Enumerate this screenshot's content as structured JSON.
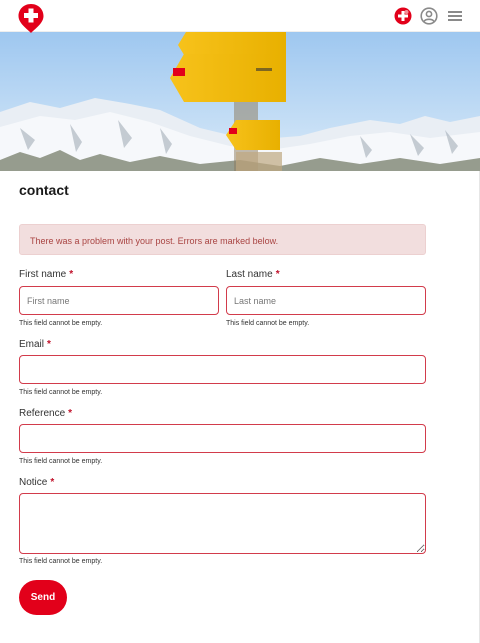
{
  "header": {
    "logo_icon": "swiss-cross-map-pin-icon",
    "icons": [
      "swiss-cross-badge-icon",
      "user-account-icon",
      "menu-icon"
    ],
    "brand_color": "#e2001a"
  },
  "hero": {
    "image": "mountain-signposts-photo"
  },
  "page": {
    "title": "contact"
  },
  "alert": {
    "text": "There was a problem with your post. Errors are marked below."
  },
  "form": {
    "required_mark": "*",
    "first_name": {
      "label": "First name",
      "placeholder": "First name",
      "value": "",
      "error": "This field cannot be empty."
    },
    "last_name": {
      "label": "Last name",
      "placeholder": "Last name",
      "value": "",
      "error": "This field cannot be empty."
    },
    "email": {
      "label": "Email",
      "value": "",
      "error": "This field cannot be empty."
    },
    "reference": {
      "label": "Reference",
      "value": "",
      "error": "This field cannot be empty."
    },
    "notice": {
      "label": "Notice",
      "value": "",
      "error": "This field cannot be empty."
    },
    "submit_label": "Send"
  },
  "colors": {
    "error_border": "#d23b4b",
    "alert_bg": "#f2dede",
    "alert_text": "#a94442",
    "button": "#e2001a"
  }
}
